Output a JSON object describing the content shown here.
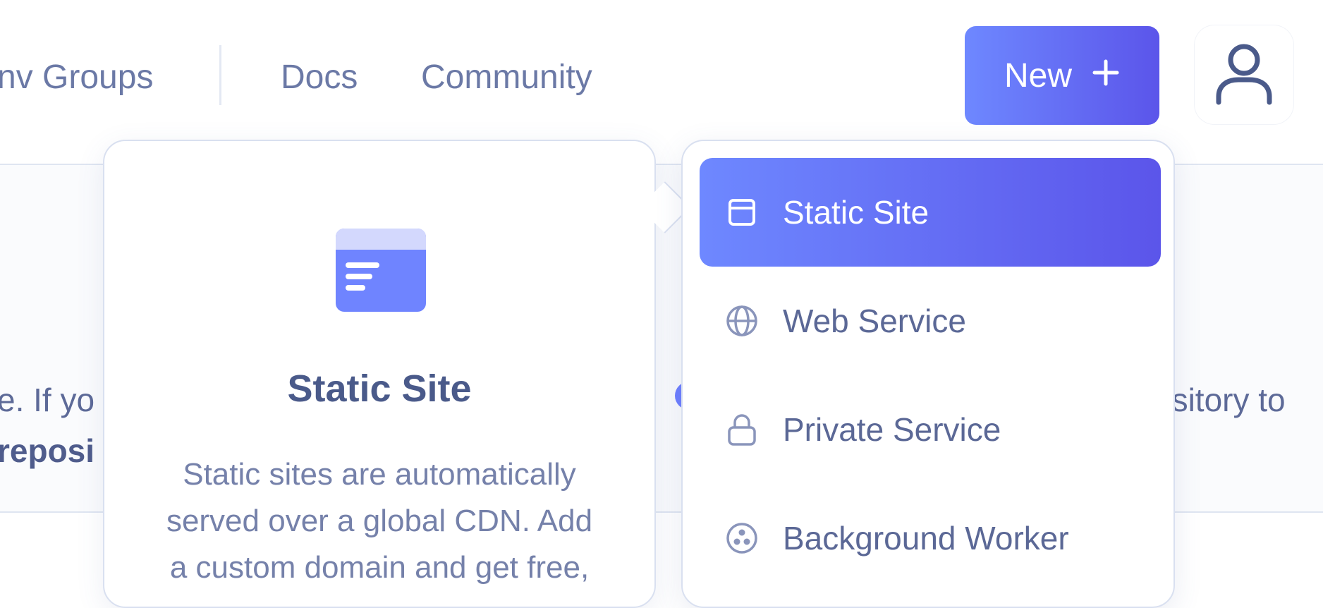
{
  "nav": {
    "links": [
      "nv Groups",
      "Docs",
      "Community"
    ],
    "new_button": {
      "label": "New",
      "icon": "plus-icon"
    },
    "avatar_icon": "user-icon"
  },
  "background": {
    "line1_left": "e. If yo",
    "line2_left": "reposi",
    "line1_right": "ository to"
  },
  "preview": {
    "icon": "static-site-illustration",
    "title": "Static Site",
    "description_lines": [
      "Static sites are automatically",
      "served over a global CDN. Add",
      "a custom domain and get free,"
    ]
  },
  "menu": {
    "items": [
      {
        "label": "Static Site",
        "icon": "browser-window-icon",
        "active": true
      },
      {
        "label": "Web Service",
        "icon": "globe-icon",
        "active": false
      },
      {
        "label": "Private Service",
        "icon": "lock-icon",
        "active": false
      },
      {
        "label": "Background Worker",
        "icon": "worker-dots-icon",
        "active": false
      }
    ]
  },
  "colors": {
    "accent_start": "#6e88ff",
    "accent_end": "#5b55ea",
    "text": "#5b6896"
  }
}
